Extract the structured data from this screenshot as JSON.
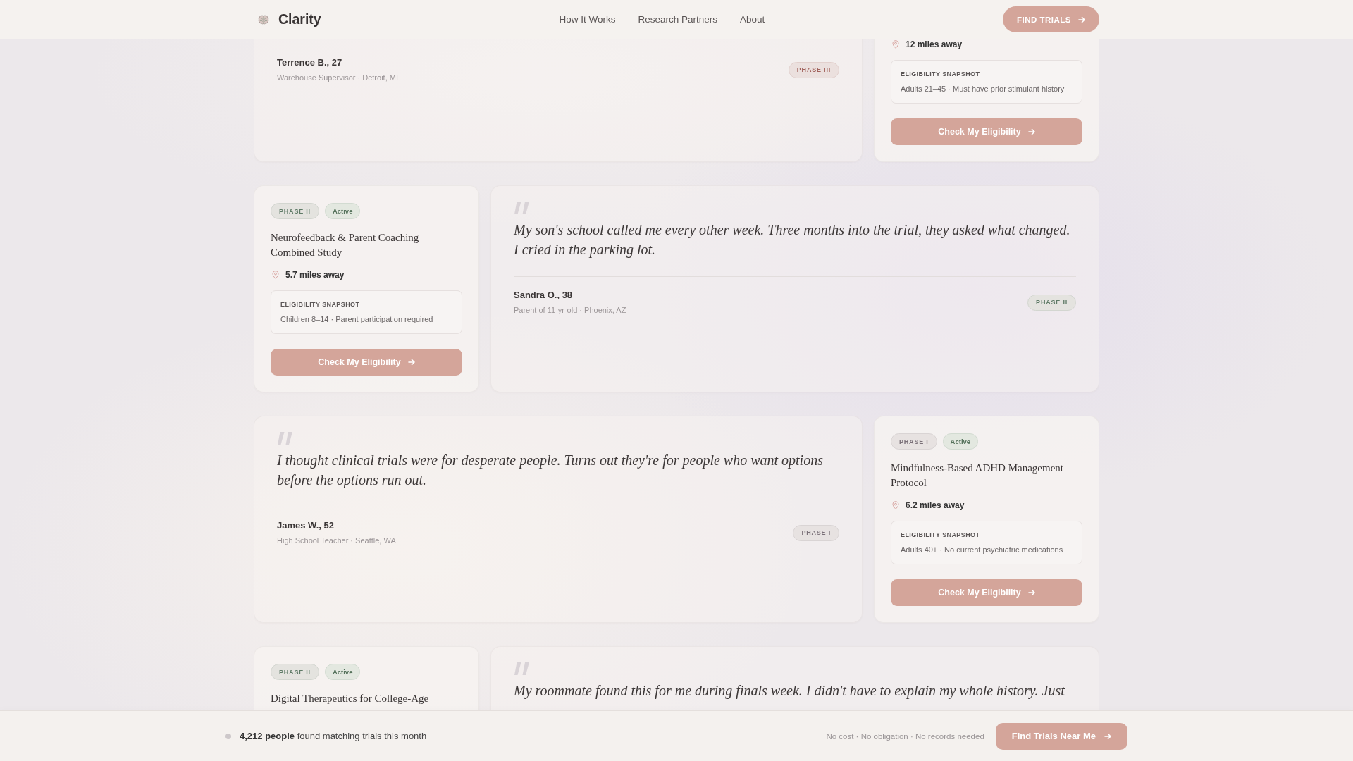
{
  "header": {
    "brand": "Clarity",
    "nav": [
      {
        "label": "How It Works"
      },
      {
        "label": "Research Partners"
      },
      {
        "label": "About"
      }
    ],
    "cta": "FIND TRIALS"
  },
  "rows": [
    {
      "cards": [
        {
          "kind": "testimonial",
          "author": "Terrence B., 27",
          "details": "Warehouse Supervisor · Detroit, MI",
          "phase": {
            "label": "PHASE III",
            "color": "#a0605a"
          }
        },
        {
          "kind": "trial",
          "distance": "12 miles away",
          "eligibility": {
            "label": "ELIGIBILITY SNAPSHOT",
            "text": "Adults 21–45 · Must have prior stimulant history"
          },
          "action": "Check My Eligibility"
        }
      ]
    },
    {
      "cards": [
        {
          "kind": "trial",
          "phase": {
            "label": "PHASE II",
            "color": "#5e7a66"
          },
          "status": "Active",
          "title": "Neurofeedback & Parent Coaching Combined Study",
          "distance": "5.7 miles away",
          "eligibility": {
            "label": "ELIGIBILITY SNAPSHOT",
            "text": "Children 8–14 · Parent participation required"
          },
          "action": "Check My Eligibility"
        },
        {
          "kind": "testimonial",
          "quote": "My son's school called me every other week. Three months into the trial, they asked what changed. I cried in the parking lot.",
          "author": "Sandra O., 38",
          "details": "Parent of 11-yr-old · Phoenix, AZ",
          "phase": {
            "label": "PHASE II",
            "color": "#5e7a66"
          }
        }
      ]
    },
    {
      "cards": [
        {
          "kind": "testimonial",
          "quote": "I thought clinical trials were for desperate people. Turns out they're for people who want options before the options run out.",
          "author": "James W., 52",
          "details": "High School Teacher · Seattle, WA",
          "phase": {
            "label": "PHASE I",
            "color": "#7a7078"
          }
        },
        {
          "kind": "trial",
          "phase": {
            "label": "PHASE I",
            "color": "#7a7078"
          },
          "status": "Active",
          "title": "Mindfulness-Based ADHD Management Protocol",
          "distance": "6.2 miles away",
          "eligibility": {
            "label": "ELIGIBILITY SNAPSHOT",
            "text": "Adults 40+ · No current psychiatric medications"
          },
          "action": "Check My Eligibility"
        }
      ]
    },
    {
      "cards": [
        {
          "kind": "trial",
          "phase": {
            "label": "PHASE II",
            "color": "#5e7a66"
          },
          "status": "Active",
          "title": "Digital Therapeutics for College-Age"
        },
        {
          "kind": "testimonial",
          "quote": "My roommate found this for me during finals week. I didn't have to explain my whole history. Just"
        }
      ]
    }
  ],
  "bottom_bar": {
    "summary": "**4,212 people** found matching trials this month",
    "assurances": "No cost · No obligation · No records needed",
    "cta": "Find Trials Near Me"
  }
}
